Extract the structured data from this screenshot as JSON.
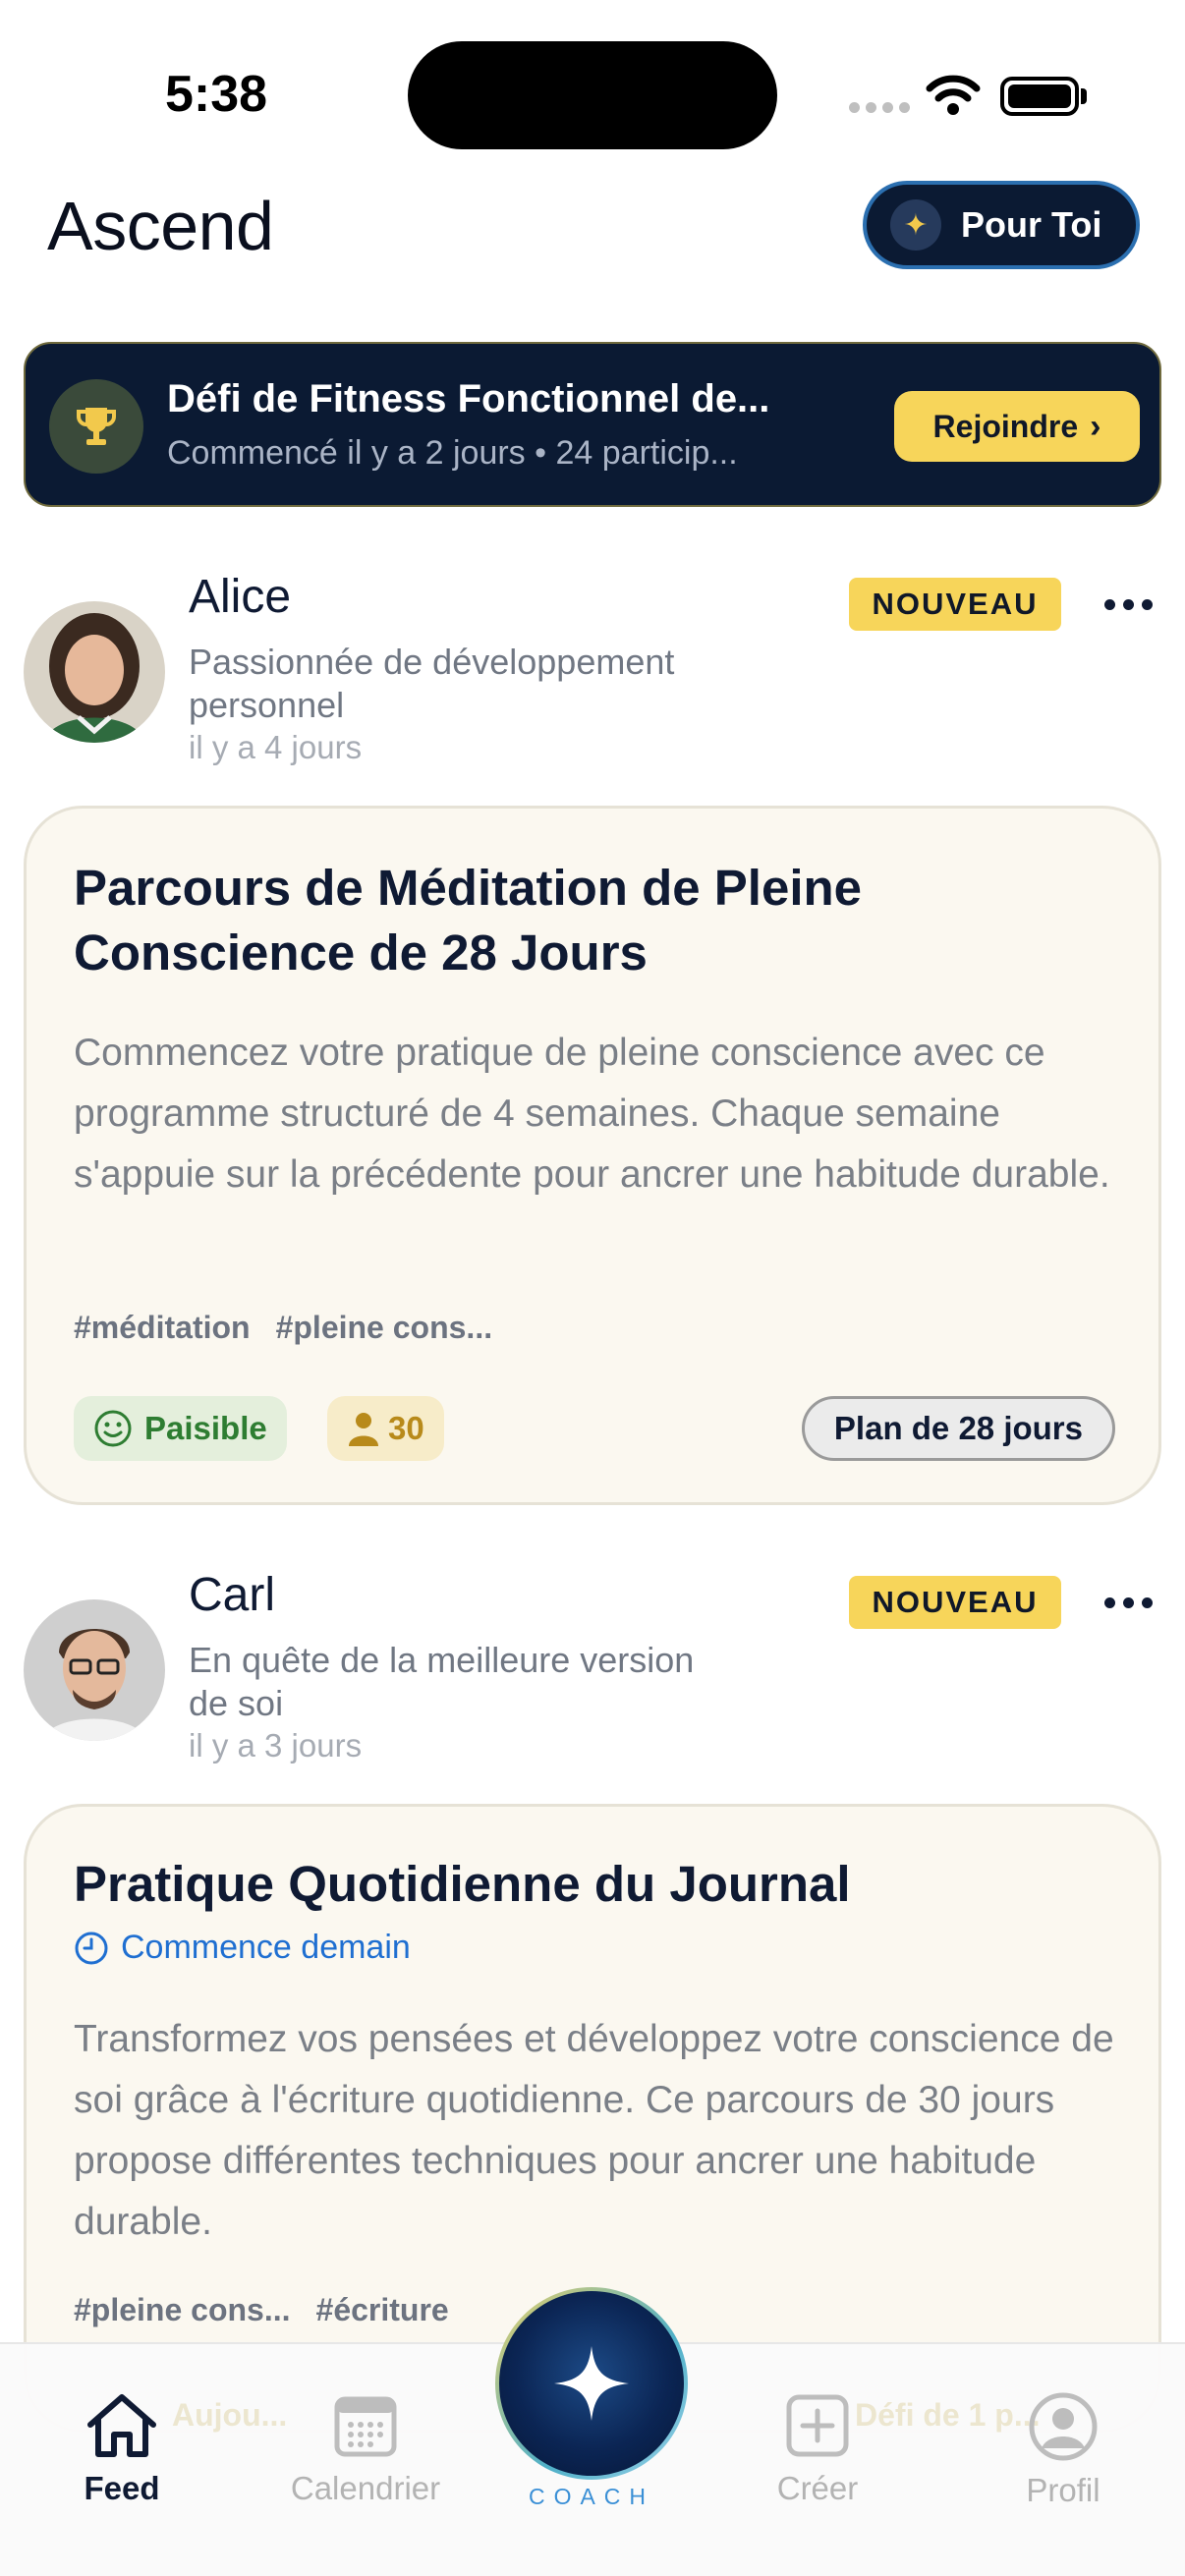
{
  "status_bar": {
    "time": "5:38"
  },
  "header": {
    "app_title": "Ascend",
    "for_you_label": "Pour Toi"
  },
  "challenge": {
    "title": "Défi de Fitness Fonctionnel de...",
    "subtitle": "Commencé il y a 2 jours • 24 particip...",
    "join_label": "Rejoindre"
  },
  "posts": [
    {
      "author": "Alice",
      "bio": "Passionnée de développement personnel",
      "time": "il y a 4 jours",
      "badge": "NOUVEAU",
      "title": "Parcours de Méditation de Pleine Conscience de 28 Jours",
      "description": "Commencez votre pratique de pleine conscience avec ce programme structuré de 4 semaines. Chaque semaine s'appuie sur la précédente pour ancrer une habitude durable.",
      "tags": [
        "#méditation",
        "#pleine cons..."
      ],
      "mood": "Paisible",
      "participants": "30",
      "plan": "Plan de 28 jours"
    },
    {
      "author": "Carl",
      "bio": "En quête de la meilleure version de soi",
      "time": "il y a 3 jours",
      "badge": "NOUVEAU",
      "title": "Pratique Quotidienne du Journal",
      "start": "Commence demain",
      "description": "Transformez vos pensées et développez votre conscience de soi grâce à l'écriture quotidienne. Ce parcours de 30 jours propose différentes techniques pour ancrer une habitude durable.",
      "tags": [
        "#pleine cons...",
        "#écriture"
      ],
      "partial_left": "Aujou...",
      "partial_right": "Défi de 1 p..."
    }
  ],
  "tab_bar": {
    "items": [
      {
        "label": "Feed",
        "icon": "home-icon",
        "active": true
      },
      {
        "label": "Calendrier",
        "icon": "calendar-icon",
        "active": false
      },
      {
        "label": "Créer",
        "icon": "plus-square-icon",
        "active": false
      },
      {
        "label": "Profil",
        "icon": "profile-icon",
        "active": false
      }
    ],
    "coach_label": "COACH"
  },
  "colors": {
    "navy": "#0b1a33",
    "accent_yellow": "#f7d55a",
    "card_bg": "#fbf8f0",
    "link_blue": "#1f6fd1",
    "mood_green": "#2e7d32"
  }
}
